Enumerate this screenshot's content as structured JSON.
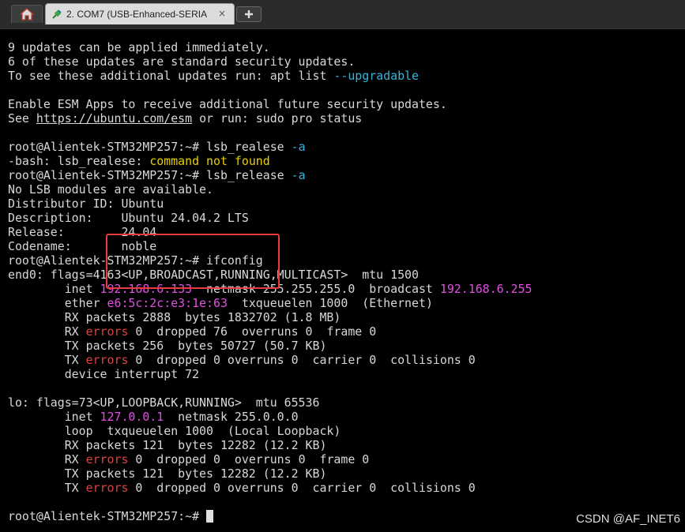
{
  "tabs": {
    "home_icon": "home-icon",
    "session_title": "2. COM7 (USB-Enhanced-SERIAL",
    "session_icon": "plug-icon",
    "close_glyph": "×",
    "new_tab_glyph": "+"
  },
  "colors": {
    "background": "#000000",
    "text": "#d8d8d8",
    "option_cyan": "#36b4dc",
    "error_yellow": "#e8d000",
    "ip_magenta": "#e24fe2",
    "errors_red": "#e0423f",
    "highlight_box": "#e83a3a"
  },
  "terminal": {
    "lines": [
      [
        {
          "t": "9 updates can be applied immediately."
        }
      ],
      [
        {
          "t": "6 of these updates are standard security updates."
        }
      ],
      [
        {
          "t": "To see these additional updates run: apt list "
        },
        {
          "t": "--upgradable",
          "c": "cyan"
        }
      ],
      [
        {
          "t": ""
        }
      ],
      [
        {
          "t": "Enable ESM Apps to receive additional future security updates."
        }
      ],
      [
        {
          "t": "See "
        },
        {
          "t": "https://ubuntu.com/esm",
          "c": "link"
        },
        {
          "t": " or run: sudo pro status"
        }
      ],
      [
        {
          "t": ""
        }
      ],
      [
        {
          "t": "root@Alientek-STM32MP257:~# lsb_realese "
        },
        {
          "t": "-a",
          "c": "cyan"
        }
      ],
      [
        {
          "t": "-bash: lsb_realese: "
        },
        {
          "t": "command not found",
          "c": "yellow"
        }
      ],
      [
        {
          "t": "root@Alientek-STM32MP257:~# lsb_release "
        },
        {
          "t": "-a",
          "c": "cyan"
        }
      ],
      [
        {
          "t": "No LSB modules are available."
        }
      ],
      [
        {
          "t": "Distributor ID: Ubuntu"
        }
      ],
      [
        {
          "t": "Description:    Ubuntu 24.04.2 LTS"
        }
      ],
      [
        {
          "t": "Release:        24.04"
        }
      ],
      [
        {
          "t": "Codename:       noble"
        }
      ],
      [
        {
          "t": "root@Alientek-STM32MP257:~# ifconfig"
        }
      ],
      [
        {
          "t": "end0: flags=4163<UP,BROADCAST,RUNNING,MULTICAST>  mtu 1500"
        }
      ],
      [
        {
          "t": "        inet "
        },
        {
          "t": "192.168.6.133",
          "c": "magenta"
        },
        {
          "t": "  netmask 255.255.255.0  broadcast "
        },
        {
          "t": "192.168.6.255",
          "c": "magenta"
        }
      ],
      [
        {
          "t": "        ether "
        },
        {
          "t": "e6:5c:2c:e3:1e:63",
          "c": "magenta"
        },
        {
          "t": "  txqueuelen 1000  (Ethernet)"
        }
      ],
      [
        {
          "t": "        RX packets 2888  bytes 1832702 (1.8 MB)"
        }
      ],
      [
        {
          "t": "        RX "
        },
        {
          "t": "errors",
          "c": "red"
        },
        {
          "t": " 0  dropped 76  overruns 0  frame 0"
        }
      ],
      [
        {
          "t": "        TX packets 256  bytes 50727 (50.7 KB)"
        }
      ],
      [
        {
          "t": "        TX "
        },
        {
          "t": "errors",
          "c": "red"
        },
        {
          "t": " 0  dropped 0 overruns 0  carrier 0  collisions 0"
        }
      ],
      [
        {
          "t": "        device interrupt 72"
        }
      ],
      [
        {
          "t": ""
        }
      ],
      [
        {
          "t": "lo: flags=73<UP,LOOPBACK,RUNNING>  mtu 65536"
        }
      ],
      [
        {
          "t": "        inet "
        },
        {
          "t": "127.0.0.1",
          "c": "magenta"
        },
        {
          "t": "  netmask 255.0.0.0"
        }
      ],
      [
        {
          "t": "        loop  txqueuelen 1000  (Local Loopback)"
        }
      ],
      [
        {
          "t": "        RX packets 121  bytes 12282 (12.2 KB)"
        }
      ],
      [
        {
          "t": "        RX "
        },
        {
          "t": "errors",
          "c": "red"
        },
        {
          "t": " 0  dropped 0  overruns 0  frame 0"
        }
      ],
      [
        {
          "t": "        TX packets 121  bytes 12282 (12.2 KB)"
        }
      ],
      [
        {
          "t": "        TX "
        },
        {
          "t": "errors",
          "c": "red"
        },
        {
          "t": " 0  dropped 0 overruns 0  carrier 0  collisions 0"
        }
      ],
      [
        {
          "t": ""
        }
      ],
      [
        {
          "t": "root@Alientek-STM32MP257:~# "
        }
      ]
    ]
  },
  "watermark": "CSDN @AF_INET6"
}
